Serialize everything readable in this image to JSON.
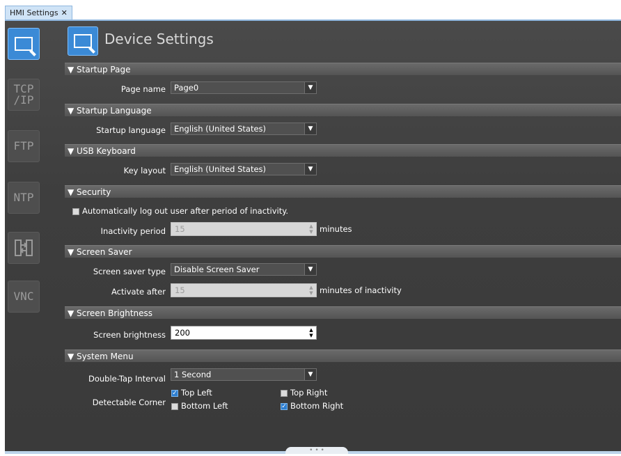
{
  "tab": {
    "label": "HMI Settings",
    "close": "✕"
  },
  "sidebar": [
    {
      "name": "device",
      "text": ""
    },
    {
      "name": "tcpip",
      "text": "TCP /IP"
    },
    {
      "name": "ftp",
      "text": "FTP"
    },
    {
      "name": "ntp",
      "text": "NTP"
    },
    {
      "name": "transfer",
      "text": ""
    },
    {
      "name": "vnc",
      "text": "VNC"
    }
  ],
  "title": "Device Settings",
  "sections": {
    "startup_page": "▼ Startup Page",
    "startup_language": "▼ Startup Language",
    "usb_keyboard": "▼ USB Keyboard",
    "security": "▼ Security",
    "screen_saver": "▼ Screen Saver",
    "screen_brightness": "▼ Screen Brightness",
    "system_menu": "▼ System Menu"
  },
  "fields": {
    "page_name": {
      "label": "Page name",
      "value": "Page0"
    },
    "startup_language": {
      "label": "Startup language",
      "value": "English (United States)"
    },
    "key_layout": {
      "label": "Key layout",
      "value": "English (United States)"
    },
    "auto_logout": {
      "label": "Automatically log out user after period of inactivity.",
      "checked": false
    },
    "inactivity_period": {
      "label": "Inactivity period",
      "value": "15",
      "unit": "minutes"
    },
    "screen_saver_type": {
      "label": "Screen saver type",
      "value": "Disable Screen Saver"
    },
    "activate_after": {
      "label": "Activate after",
      "value": "15",
      "unit": "minutes of inactivity"
    },
    "screen_brightness": {
      "label": "Screen brightness",
      "value": "200"
    },
    "double_tap": {
      "label": "Double-Tap Interval",
      "value": "1 Second"
    },
    "detectable_corner": {
      "label": "Detectable Corner",
      "top_left": {
        "label": "Top Left",
        "checked": true
      },
      "top_right": {
        "label": "Top Right",
        "checked": false
      },
      "bottom_left": {
        "label": "Bottom Left",
        "checked": false
      },
      "bottom_right": {
        "label": "Bottom Right",
        "checked": true
      }
    }
  },
  "dropdown_arrow": "▼",
  "spinner": {
    "up": "▲",
    "down": "▼"
  },
  "checkmark": "✓",
  "grip": "• • •"
}
